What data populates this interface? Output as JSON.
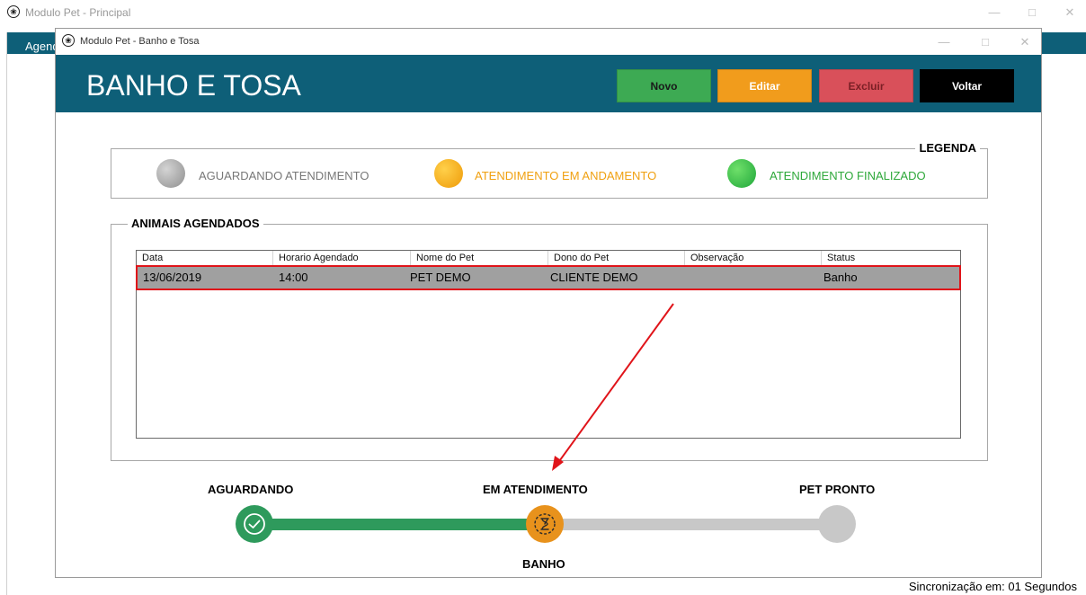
{
  "main_window": {
    "title": "Modulo Pet - Principal",
    "menu_item": "Agend",
    "minimize": "—",
    "maximize": "□",
    "close": "✕",
    "icon": "paw-icon"
  },
  "dialog": {
    "title": "Modulo Pet - Banho e Tosa",
    "minimize": "—",
    "maximize": "□",
    "close": "✕",
    "icon": "paw-icon"
  },
  "header": {
    "title": "BANHO E TOSA",
    "buttons": {
      "novo": "Novo",
      "editar": "Editar",
      "excluir": "Excluir",
      "voltar": "Voltar"
    }
  },
  "legend": {
    "title": "LEGENDA",
    "items": [
      {
        "label": "AGUARDANDO ATENDIMENTO",
        "color": "#9a9a9a"
      },
      {
        "label": "ATENDIMENTO EM ANDAMENTO",
        "color": "#f5a20a"
      },
      {
        "label": "ATENDIMENTO FINALIZADO",
        "color": "#2bb24c"
      }
    ]
  },
  "animais": {
    "title": "ANIMAIS AGENDADOS",
    "columns": [
      "Data",
      "Horario Agendado",
      "Nome do Pet",
      "Dono do Pet",
      "Observação",
      "Status"
    ],
    "rows": [
      [
        "13/06/2019",
        "14:00",
        "PET DEMO",
        "CLIENTE DEMO",
        "",
        "Banho"
      ]
    ]
  },
  "progress": {
    "steps": [
      {
        "label": "AGUARDANDO",
        "state": "done",
        "icon": "check-icon"
      },
      {
        "label": "EM ATENDIMENTO",
        "state": "active",
        "icon": "hourglass-icon",
        "sublabel": "BANHO"
      },
      {
        "label": "PET PRONTO",
        "state": "pending"
      }
    ],
    "colors": {
      "done": "#2e9a5c",
      "active": "#e8921c",
      "pending": "#c8c8c8"
    }
  },
  "status_bar": {
    "sync": "Sincronização em: 01 Segundos"
  }
}
